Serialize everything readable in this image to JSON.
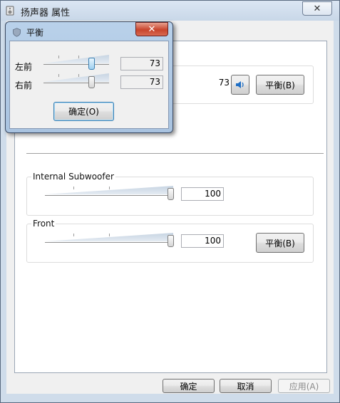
{
  "main_window": {
    "title": "扬声器 属性",
    "close_glyph": "✕",
    "icon": "speaker-properties-icon"
  },
  "main_panel": {
    "top_group": {
      "value": "73",
      "mute_icon": "speaker-icon",
      "balance_button": "平衡(B)"
    },
    "channels": [
      {
        "name": "Internal Subwoofer",
        "value": "100",
        "level_fraction": 1.0
      },
      {
        "name": "Front",
        "value": "100",
        "level_fraction": 1.0,
        "balance_button": "平衡(B)"
      }
    ]
  },
  "footer": {
    "ok": "确定",
    "cancel": "取消",
    "apply": "应用(A)"
  },
  "balance_dialog": {
    "title": "平衡",
    "close_glyph": "✕",
    "icon": "shield-icon",
    "rows": [
      {
        "label": "左前",
        "value": "73",
        "level_fraction": 0.73
      },
      {
        "label": "右前",
        "value": "73",
        "level_fraction": 0.73
      }
    ],
    "ok": "确定(O)"
  }
}
